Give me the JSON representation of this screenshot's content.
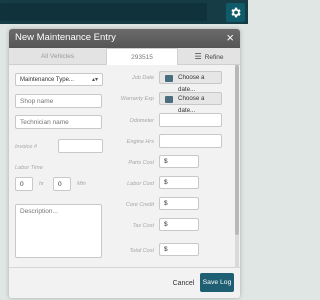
{
  "colors": {
    "topbar": "#163c46",
    "accent": "#1e5f73",
    "header": "#5f5f5f"
  },
  "modal": {
    "title": "New Maintenance Entry",
    "close_label": "×",
    "tabs": [
      "All Vehicles",
      "293515",
      "Refine"
    ]
  },
  "form": {
    "type_select": "Maintenance Type...",
    "shop_placeholder": "Shop name",
    "technician_placeholder": "Technician name",
    "invoice_label": "Invoice #",
    "labor_time_label": "Labor Time",
    "hours_value": "0",
    "hr_label": "hr",
    "minutes_value": "0",
    "min_label": "Min",
    "description_placeholder": "Description...",
    "job_date_label": "Job Date",
    "warranty_exp_label": "Warranty Exp",
    "odometer_label": "Odometer",
    "engine_hrs_label": "Engine Hrs",
    "parts_cost_label": "Parts Cost",
    "labor_cost_label": "Labor Cost",
    "core_credit_label": "Core Credit",
    "tax_cost_label": "Tax Cost",
    "total_cost_label": "Total Cost",
    "choose_date": "Choose a date...",
    "dollar": "$"
  },
  "footer": {
    "cancel_label": "Cancel",
    "save_label": "Save Log"
  }
}
